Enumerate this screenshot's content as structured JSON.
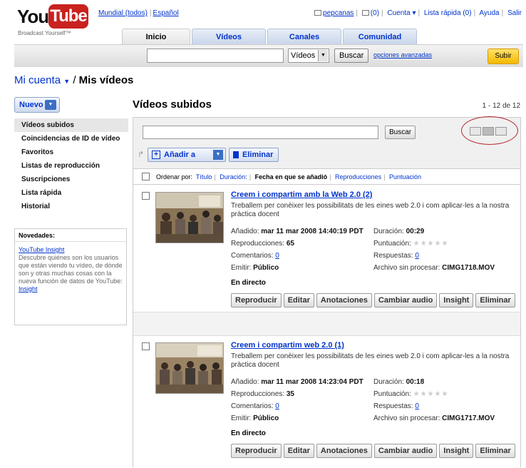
{
  "header": {
    "logo": {
      "you": "You",
      "tube": "Tube",
      "tagline": "Broadcast Yourself™"
    },
    "locale": {
      "region": "Mundial (todos)",
      "language": "Español"
    },
    "top_links": {
      "user": "pepcanas",
      "inbox": "(0)",
      "account": "Cuenta ▾",
      "quicklist": "Lista rápida (0)",
      "help": "Ayuda",
      "logout": "Salir"
    },
    "tabs": [
      "Inicio",
      "Vídeos",
      "Canales",
      "Comunidad"
    ],
    "search": {
      "select_value": "Vídeos",
      "button": "Buscar",
      "advanced": "opciones avanzadas"
    },
    "upload": "Subir"
  },
  "breadcrumb": {
    "account": "Mi cuenta",
    "sep": "/",
    "current": "Mis vídeos"
  },
  "new_button": "Nuevo",
  "page_heading": "Vídeos subidos",
  "pager": "1 - 12 de 12",
  "sidebar": {
    "items": [
      "Vídeos subidos",
      "Coincidencias de ID de vídeo",
      "Favoritos",
      "Listas de reproducción",
      "Suscripciones",
      "Lista rápida",
      "Historial"
    ],
    "news": {
      "title": "Novedades:",
      "link": "YouTube Insight",
      "text": "Descubre quiénes son los usuarios que están viendo tu vídeo, de dónde son y otras muchas cosas con la nueva función de datos de YouTube:",
      "link2": "Insight"
    }
  },
  "toolbar": {
    "filter_button": "Buscar",
    "add_to": "Añadir a",
    "delete": "Eliminar"
  },
  "sort": {
    "label": "Ordenar por:",
    "title": "Título",
    "duration": "Duración:",
    "date": "Fecha en que se añadió",
    "views": "Reproducciones",
    "rating": "Puntuación"
  },
  "videos": [
    {
      "title": "Creem i compartim amb la Web 2.0 (2)",
      "desc": "Treballem per conèixer les possibilitats de les eines web 2.0 i com aplicar-les a la nostra pràctica docent",
      "added_label": "Añadido:",
      "added": "mar 11 mar 2008 14:40:19 PDT",
      "duration_label": "Duración:",
      "duration": "00:29",
      "views_label": "Reproducciones:",
      "views": "65",
      "rating_label": "Puntuación:",
      "stars": "★★★★★",
      "comments_label": "Comentarios:",
      "comments": "0",
      "replies_label": "Respuestas:",
      "replies": "0",
      "broadcast_label": "Emitir:",
      "broadcast": "Público",
      "raw_label": "Archivo sin procesar:",
      "raw": "CIMG1718.MOV",
      "status": "En directo"
    },
    {
      "title": "Creem i compartim web 2.0 (1)",
      "desc": "Treballem per conèixer les possibilitats de les eines web 2.0 i com aplicar-les a la nostra pràctica docent",
      "added_label": "Añadido:",
      "added": "mar 11 mar 2008 14:23:04 PDT",
      "duration_label": "Duración:",
      "duration": "00:18",
      "views_label": "Reproducciones:",
      "views": "35",
      "rating_label": "Puntuación:",
      "stars": "★★★★★",
      "comments_label": "Comentarios:",
      "comments": "0",
      "replies_label": "Respuestas:",
      "replies": "0",
      "broadcast_label": "Emitir:",
      "broadcast": "Público",
      "raw_label": "Archivo sin procesar:",
      "raw": "CIMG1717.MOV",
      "status": "En directo"
    }
  ],
  "video_buttons": [
    "Reproducir",
    "Editar",
    "Anotaciones",
    "Cambiar audio",
    "Insight",
    "Eliminar"
  ],
  "colors": {
    "link": "#0033cc",
    "logo_red": "#c9221f",
    "highlight_circle": "#b5272e",
    "upload": "#f4b800"
  }
}
